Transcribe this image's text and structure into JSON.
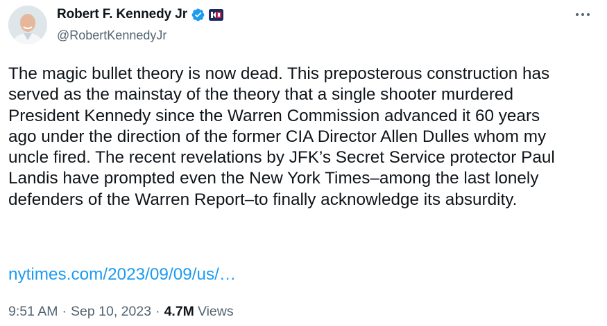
{
  "author": {
    "display_name": "Robert F. Kennedy Jr",
    "handle": "@RobertKennedyJr",
    "verified_icon": "verified-badge-icon",
    "affiliate_badge_icon": "campaign-logo-badge-icon",
    "verified_color": "#1d9bf0"
  },
  "tweet": {
    "text": "The magic bullet theory is now dead. This preposterous construction has\nserved as the mainstay of the theory that a single shooter murdered\nPresident Kennedy since the Warren Commission advanced it 60 years\nago under the direction of the former CIA Director Allen Dulles whom my\nuncle fired. The recent revelations by JFK’s Secret Service protector Paul\nLandis have prompted even the New York Times–among the last lonely\ndefenders of the Warren Report–to finally acknowledge its absurdity.",
    "link_text": "nytimes.com/2023/09/09/us/…",
    "link_color": "#1d9bf0"
  },
  "meta": {
    "time": "9:51 AM",
    "separator": "·",
    "date": "Sep 10, 2023",
    "views_count": "4.7M",
    "views_label": "Views"
  },
  "actions": {
    "more_icon": "more-options-icon"
  }
}
